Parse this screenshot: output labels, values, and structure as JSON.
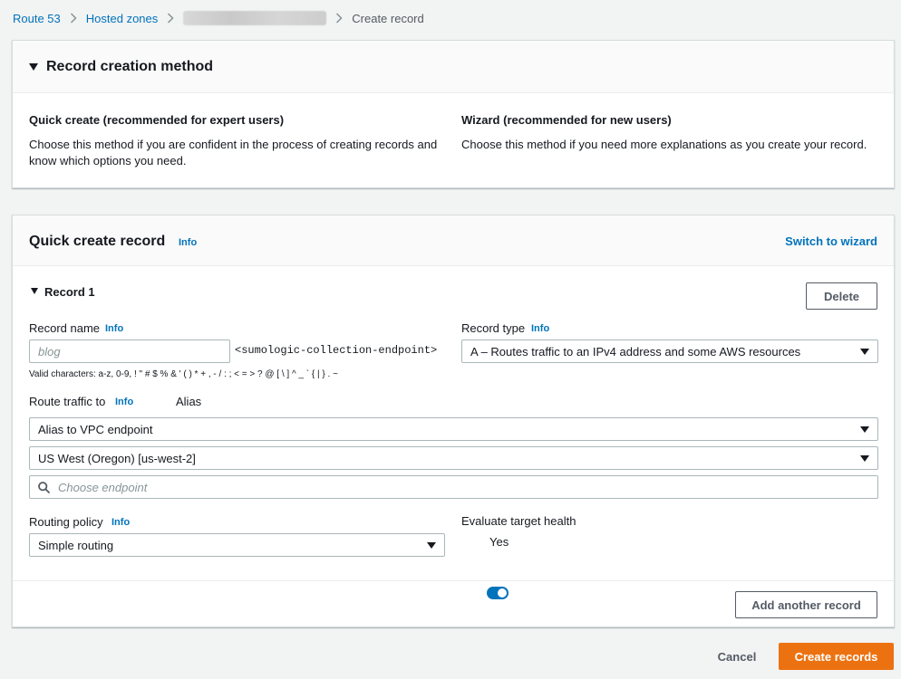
{
  "breadcrumb": {
    "route53": "Route 53",
    "hosted_zones": "Hosted zones",
    "current": "Create record"
  },
  "method_panel": {
    "title": "Record creation method",
    "quick": {
      "title": "Quick create (recommended for expert users)",
      "desc": "Choose this method if you are confident in the process of creating records and know which options you need."
    },
    "wizard": {
      "title": "Wizard (recommended for new users)",
      "desc": "Choose this method if you need more explanations as you create your record."
    }
  },
  "quick_panel": {
    "title": "Quick create record",
    "info": "Info",
    "switch_link": "Switch to wizard"
  },
  "record": {
    "title": "Record 1",
    "delete_label": "Delete",
    "name_label": "Record name",
    "name_info": "Info",
    "name_placeholder": "blog",
    "name_suffix": "<sumologic-collection-endpoint>",
    "valid_chars": "Valid characters: a-z, 0-9, ! \" # $ % & ' ( ) * + , - / : ; < = > ? @ [ \\ ] ^ _ ` { | } . ~",
    "type_label": "Record type",
    "type_info": "Info",
    "type_value": "A – Routes traffic to an IPv4 address and some AWS resources",
    "route_label": "Route traffic to",
    "route_info": "Info",
    "alias_label": "Alias",
    "alias_target": "Alias to VPC endpoint",
    "region": "US West (Oregon) [us-west-2]",
    "endpoint_placeholder": "Choose endpoint",
    "routing_label": "Routing policy",
    "routing_info": "Info",
    "routing_value": "Simple routing",
    "health_label": "Evaluate target health",
    "health_value": "Yes"
  },
  "add_another_label": "Add another record",
  "footer": {
    "cancel_label": "Cancel",
    "create_label": "Create records"
  },
  "colors": {
    "link": "#0073bb",
    "primary": "#ec7211",
    "toggle": "#0073bb"
  }
}
